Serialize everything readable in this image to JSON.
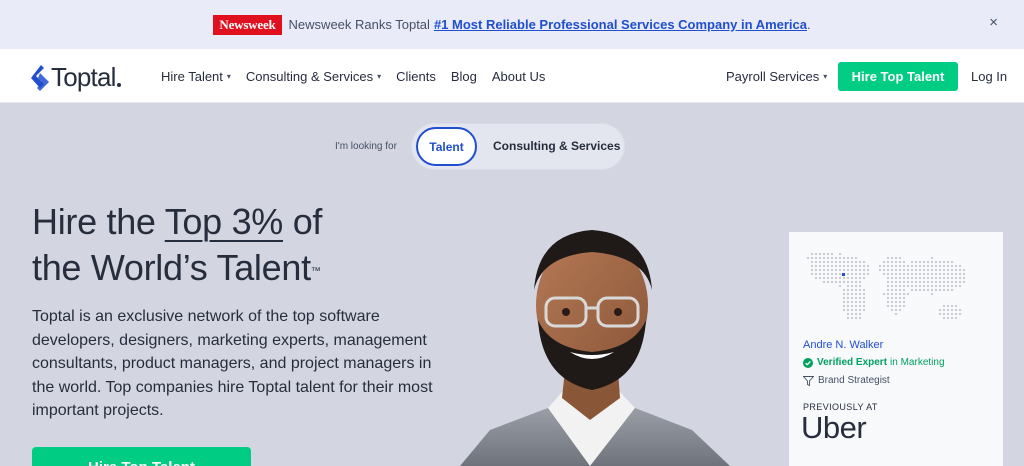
{
  "announcement": {
    "brand": "Newsweek",
    "text": "Newsweek Ranks Toptal",
    "link": "#1 Most Reliable Professional Services Company in America",
    "suffix": ".",
    "close": "×"
  },
  "header": {
    "logo": "Toptal",
    "nav": [
      {
        "label": "Hire Talent",
        "dropdown": true
      },
      {
        "label": "Consulting & Services",
        "dropdown": true
      },
      {
        "label": "Clients",
        "dropdown": false
      },
      {
        "label": "Blog",
        "dropdown": false
      },
      {
        "label": "About Us",
        "dropdown": false
      }
    ],
    "payroll": "Payroll Services",
    "hire_button": "Hire Top Talent",
    "login": "Log In"
  },
  "toggle": {
    "prompt": "I'm looking for",
    "option_talent": "Talent",
    "option_consulting": "Consulting & Services",
    "selected": "Talent"
  },
  "hero": {
    "headline_pre": "Hire the ",
    "headline_highlight": "Top 3%",
    "headline_mid": " of",
    "headline_line2": "the World’s Talent",
    "trademark": "™",
    "description": "Toptal is an exclusive network of the top software developers, designers, marketing experts, management consultants, product managers, and project managers in the world. Top companies hire Toptal talent for their most important projects.",
    "cta": "Hire Top Talent"
  },
  "card": {
    "name": "Andre N. Walker",
    "verified_label": "Verified Expert",
    "verified_field": "in Marketing",
    "role": "Brand Strategist",
    "previously": "PREVIOUSLY AT",
    "company": "Uber"
  },
  "colors": {
    "accent_blue": "#204ecf",
    "accent_green": "#00cc83",
    "brand_red": "#e0101f"
  },
  "icons": [
    "toptal-logo-icon",
    "chevron-down-icon",
    "close-icon",
    "verified-check-icon",
    "funnel-icon",
    "world-map-icon"
  ]
}
